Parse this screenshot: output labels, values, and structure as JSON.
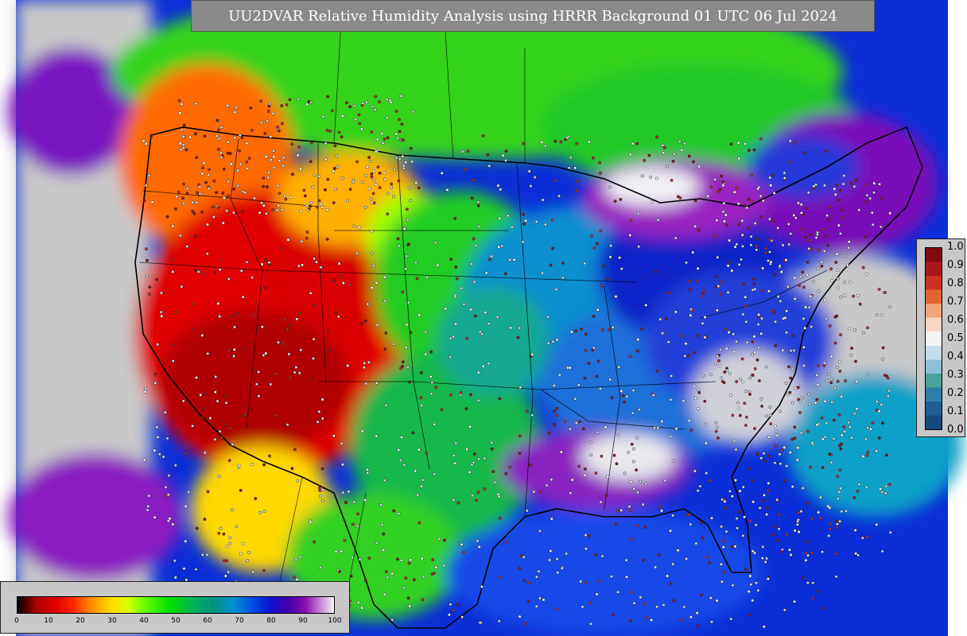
{
  "title": "UU2DVAR Relative Humidity Analysis using HRRR Background 01 UTC 06 Jul 2024",
  "right_colorbar": {
    "ticks": [
      "1.0",
      "0.9",
      "0.8",
      "0.7",
      "0.6",
      "0.5",
      "0.4",
      "0.3",
      "0.2",
      "0.1",
      "0.0"
    ],
    "colors": [
      "#7f0a0f",
      "#a8171b",
      "#c8321f",
      "#e0662c",
      "#efa57a",
      "#f9d6c4",
      "#f3f3f3",
      "#c5dcea",
      "#8fc0d9",
      "#4aa29a",
      "#2d7fa9",
      "#1f5e92",
      "#174a7a"
    ]
  },
  "bottom_colorbar": {
    "ticks": [
      "0",
      "10",
      "20",
      "30",
      "40",
      "50",
      "60",
      "70",
      "80",
      "90",
      "100"
    ]
  },
  "icons": {
    "map": "rh-map-icon"
  }
}
